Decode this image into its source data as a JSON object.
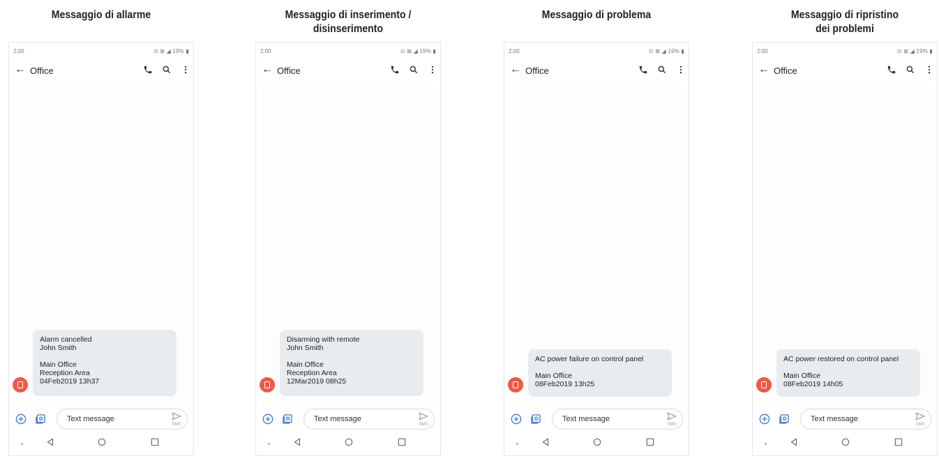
{
  "columns": [
    {
      "caption": "Messaggio di allarme",
      "status": {
        "time": "2:00",
        "icons": "⊙ ⊞ ◢ 19% ▮"
      },
      "appbar": {
        "back": "←",
        "title": "Office"
      },
      "message": "Alarm cancelled\nJohn Smith\n\nMain Office\nReception Area\n04Feb2019 13h37",
      "composer": {
        "placeholder": "Text message",
        "send_sub": "SMS"
      }
    },
    {
      "caption": "Messaggio di inserimento /\ndisinserimento",
      "status": {
        "time": "2:00",
        "icons": "⊙ ⊞ ◢ 19% ▮"
      },
      "appbar": {
        "back": "←",
        "title": "Office"
      },
      "message": "Disarming with remote\nJohn Smith\n\nMain Office\nReception Area\n12Mar2019 08h25",
      "composer": {
        "placeholder": "Text message",
        "send_sub": "SMS"
      }
    },
    {
      "caption": "Messaggio di problema",
      "status": {
        "time": "2:00",
        "icons": "⊙ ⊞ ◢ 19% ▮"
      },
      "appbar": {
        "back": "←",
        "title": "Office"
      },
      "message": "AC power failure on control panel\n\nMain Office\n08Feb2019 13h25",
      "composer": {
        "placeholder": "Text message",
        "send_sub": "SMS"
      }
    },
    {
      "caption": "Messaggio di ripristino\ndei problemi",
      "status": {
        "time": "2:00",
        "icons": "⊙ ⊞ ◢ 19% ▮"
      },
      "appbar": {
        "back": "←",
        "title": "Office"
      },
      "message": "AC power restored on control panel\n\nMain Office\n08Feb2019 14h05",
      "composer": {
        "placeholder": "Text message",
        "send_sub": "SMS"
      }
    }
  ],
  "colors": {
    "avatar": "#ee5a47",
    "accent": "#3a78d8",
    "bubble": "#e9ecee"
  },
  "icons": [
    "back-arrow-icon",
    "phone-icon",
    "search-icon",
    "more-vert-icon",
    "add-icon",
    "gallery-icon",
    "send-icon",
    "back-nav-icon",
    "home-nav-icon",
    "recents-nav-icon"
  ]
}
